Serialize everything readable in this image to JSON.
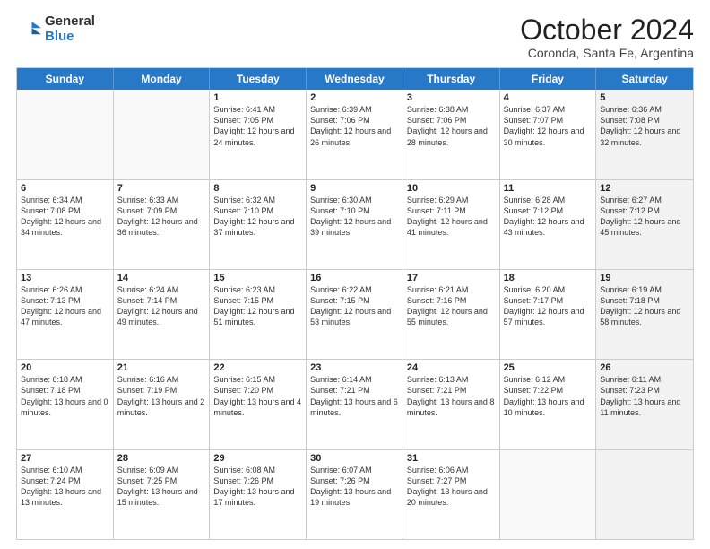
{
  "logo": {
    "general": "General",
    "blue": "Blue"
  },
  "title": "October 2024",
  "location": "Coronda, Santa Fe, Argentina",
  "days_of_week": [
    "Sunday",
    "Monday",
    "Tuesday",
    "Wednesday",
    "Thursday",
    "Friday",
    "Saturday"
  ],
  "weeks": [
    [
      {
        "day": "",
        "info": "",
        "empty": true
      },
      {
        "day": "",
        "info": "",
        "empty": true
      },
      {
        "day": "1",
        "info": "Sunrise: 6:41 AM\nSunset: 7:05 PM\nDaylight: 12 hours and 24 minutes."
      },
      {
        "day": "2",
        "info": "Sunrise: 6:39 AM\nSunset: 7:06 PM\nDaylight: 12 hours and 26 minutes."
      },
      {
        "day": "3",
        "info": "Sunrise: 6:38 AM\nSunset: 7:06 PM\nDaylight: 12 hours and 28 minutes."
      },
      {
        "day": "4",
        "info": "Sunrise: 6:37 AM\nSunset: 7:07 PM\nDaylight: 12 hours and 30 minutes."
      },
      {
        "day": "5",
        "info": "Sunrise: 6:36 AM\nSunset: 7:08 PM\nDaylight: 12 hours and 32 minutes.",
        "shaded": true
      }
    ],
    [
      {
        "day": "6",
        "info": "Sunrise: 6:34 AM\nSunset: 7:08 PM\nDaylight: 12 hours and 34 minutes."
      },
      {
        "day": "7",
        "info": "Sunrise: 6:33 AM\nSunset: 7:09 PM\nDaylight: 12 hours and 36 minutes."
      },
      {
        "day": "8",
        "info": "Sunrise: 6:32 AM\nSunset: 7:10 PM\nDaylight: 12 hours and 37 minutes."
      },
      {
        "day": "9",
        "info": "Sunrise: 6:30 AM\nSunset: 7:10 PM\nDaylight: 12 hours and 39 minutes."
      },
      {
        "day": "10",
        "info": "Sunrise: 6:29 AM\nSunset: 7:11 PM\nDaylight: 12 hours and 41 minutes."
      },
      {
        "day": "11",
        "info": "Sunrise: 6:28 AM\nSunset: 7:12 PM\nDaylight: 12 hours and 43 minutes."
      },
      {
        "day": "12",
        "info": "Sunrise: 6:27 AM\nSunset: 7:12 PM\nDaylight: 12 hours and 45 minutes.",
        "shaded": true
      }
    ],
    [
      {
        "day": "13",
        "info": "Sunrise: 6:26 AM\nSunset: 7:13 PM\nDaylight: 12 hours and 47 minutes."
      },
      {
        "day": "14",
        "info": "Sunrise: 6:24 AM\nSunset: 7:14 PM\nDaylight: 12 hours and 49 minutes."
      },
      {
        "day": "15",
        "info": "Sunrise: 6:23 AM\nSunset: 7:15 PM\nDaylight: 12 hours and 51 minutes."
      },
      {
        "day": "16",
        "info": "Sunrise: 6:22 AM\nSunset: 7:15 PM\nDaylight: 12 hours and 53 minutes."
      },
      {
        "day": "17",
        "info": "Sunrise: 6:21 AM\nSunset: 7:16 PM\nDaylight: 12 hours and 55 minutes."
      },
      {
        "day": "18",
        "info": "Sunrise: 6:20 AM\nSunset: 7:17 PM\nDaylight: 12 hours and 57 minutes."
      },
      {
        "day": "19",
        "info": "Sunrise: 6:19 AM\nSunset: 7:18 PM\nDaylight: 12 hours and 58 minutes.",
        "shaded": true
      }
    ],
    [
      {
        "day": "20",
        "info": "Sunrise: 6:18 AM\nSunset: 7:18 PM\nDaylight: 13 hours and 0 minutes."
      },
      {
        "day": "21",
        "info": "Sunrise: 6:16 AM\nSunset: 7:19 PM\nDaylight: 13 hours and 2 minutes."
      },
      {
        "day": "22",
        "info": "Sunrise: 6:15 AM\nSunset: 7:20 PM\nDaylight: 13 hours and 4 minutes."
      },
      {
        "day": "23",
        "info": "Sunrise: 6:14 AM\nSunset: 7:21 PM\nDaylight: 13 hours and 6 minutes."
      },
      {
        "day": "24",
        "info": "Sunrise: 6:13 AM\nSunset: 7:21 PM\nDaylight: 13 hours and 8 minutes."
      },
      {
        "day": "25",
        "info": "Sunrise: 6:12 AM\nSunset: 7:22 PM\nDaylight: 13 hours and 10 minutes."
      },
      {
        "day": "26",
        "info": "Sunrise: 6:11 AM\nSunset: 7:23 PM\nDaylight: 13 hours and 11 minutes.",
        "shaded": true
      }
    ],
    [
      {
        "day": "27",
        "info": "Sunrise: 6:10 AM\nSunset: 7:24 PM\nDaylight: 13 hours and 13 minutes."
      },
      {
        "day": "28",
        "info": "Sunrise: 6:09 AM\nSunset: 7:25 PM\nDaylight: 13 hours and 15 minutes."
      },
      {
        "day": "29",
        "info": "Sunrise: 6:08 AM\nSunset: 7:26 PM\nDaylight: 13 hours and 17 minutes."
      },
      {
        "day": "30",
        "info": "Sunrise: 6:07 AM\nSunset: 7:26 PM\nDaylight: 13 hours and 19 minutes."
      },
      {
        "day": "31",
        "info": "Sunrise: 6:06 AM\nSunset: 7:27 PM\nDaylight: 13 hours and 20 minutes."
      },
      {
        "day": "",
        "info": "",
        "empty": true
      },
      {
        "day": "",
        "info": "",
        "empty": true,
        "shaded": true
      }
    ]
  ]
}
